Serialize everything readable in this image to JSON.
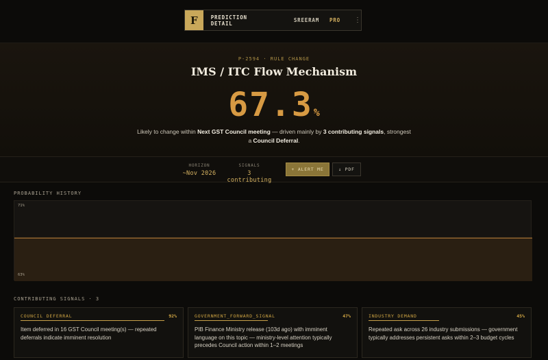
{
  "nav": {
    "logo": "F",
    "title": "PREDICTION DETAIL",
    "user": "SREERAM",
    "plan": "PRO",
    "menu": "⋮"
  },
  "hero": {
    "kicker": "P-2594 · RULE CHANGE",
    "title": "IMS / ITC Flow Mechanism",
    "probability_value": "67.3",
    "probability_unit": "%",
    "summary": {
      "t1": "Likely to change within ",
      "b1": "Next GST Council meeting",
      "t2": " — driven mainly by ",
      "b2": "3 contributing signals",
      "t3": ", strongest a ",
      "b3": "Council Deferral",
      "t4": "."
    }
  },
  "meta": {
    "horizon_label": "HORIZON",
    "horizon_value": "~Nov 2026",
    "signals_label": "SIGNALS",
    "signals_value": "3 contributing",
    "alert_button": "+ ALERT ME",
    "pdf_button": "↓ PDF"
  },
  "history": {
    "label": "PROBABILITY HISTORY",
    "y_top": "71%",
    "y_bottom": "63%"
  },
  "chart_data": {
    "type": "area",
    "ylim": [
      63,
      71
    ],
    "series": [
      {
        "values": [
          67.3,
          67.3
        ]
      }
    ],
    "line_color": "#c98a3e"
  },
  "signals": {
    "label": "CONTRIBUTING SIGNALS · 3",
    "items": [
      {
        "name": "COUNCIL DEFERRAL",
        "pct": "92%",
        "weight": 0.92,
        "text": "Item deferred in 16 GST Council meeting(s) — repeated deferrals indicate imminent resolution"
      },
      {
        "name": "GOVERNMENT_FORWARD_SIGNAL",
        "pct": "47%",
        "weight": 0.47,
        "text": "PIB Finance Ministry release (103d ago) with imminent language on this topic — ministry-level attention typically precedes Council action within 1–2 meetings"
      },
      {
        "name": "INDUSTRY DEMAND",
        "pct": "45%",
        "weight": 0.45,
        "text": "Repeated ask across 26 industry submissions — government typically addresses persistent asks within 2–3 budget cycles"
      }
    ]
  }
}
